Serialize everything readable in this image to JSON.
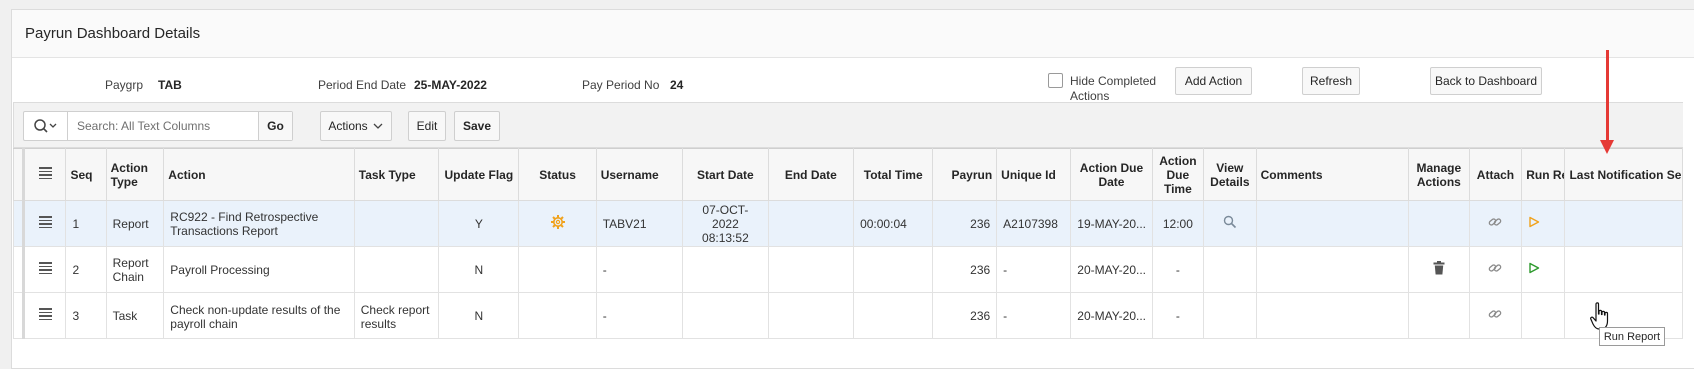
{
  "region": {
    "title": "Payrun Dashboard Details"
  },
  "info": {
    "paygrp_label": "Paygrp",
    "paygrp_value": "TAB",
    "period_end_label": "Period End Date",
    "period_end_value": "25-MAY-2022",
    "pay_period_label": "Pay Period No",
    "pay_period_value": "24"
  },
  "controls": {
    "hide_completed_label_1": "Hide Completed",
    "hide_completed_label_2": "Actions",
    "hide_completed_checked": false,
    "add_action": "Add Action",
    "refresh": "Refresh",
    "back": "Back to Dashboard"
  },
  "toolbar": {
    "search_placeholder": "Search: All Text Columns",
    "go": "Go",
    "actions": "Actions",
    "edit": "Edit",
    "save": "Save"
  },
  "columns": [
    {
      "label": "Seq"
    },
    {
      "label": "Action Type"
    },
    {
      "label": "Action"
    },
    {
      "label": "Task Type"
    },
    {
      "label": "Update Flag"
    },
    {
      "label": "Status"
    },
    {
      "label": "Username"
    },
    {
      "label": "Start Date"
    },
    {
      "label": "End Date"
    },
    {
      "label": "Total Time"
    },
    {
      "label": "Payrun"
    },
    {
      "label": "Unique Id"
    },
    {
      "label": "Action Due Date"
    },
    {
      "label": "Action Due Time"
    },
    {
      "label": "View Details"
    },
    {
      "label": "Comments"
    },
    {
      "label": "Manage Actions"
    },
    {
      "label": "Attach"
    },
    {
      "label": "Run Report"
    },
    {
      "label": "Last Notification Sent"
    }
  ],
  "rows": [
    {
      "seq": "1",
      "action_type": "Report",
      "action": "RC922 - Find Retrospective Transactions Report",
      "task_type": "",
      "update_flag": "Y",
      "status_icon": "gear-icon",
      "username": "TABV21",
      "start_date": "07-OCT-2022 08:13:52",
      "end_date": "",
      "total_time": "00:00:04",
      "payrun": "236",
      "unique_id": "A2107398",
      "due_date": "19-MAY-20...",
      "due_time": "12:00",
      "view_icon": "search-icon",
      "comments": "",
      "manage_icon": "",
      "attach_icon": "link-icon",
      "run_icon": "play-icon-orange",
      "selected": true
    },
    {
      "seq": "2",
      "action_type": "Report Chain",
      "action": "Payroll Processing",
      "task_type": "",
      "update_flag": "N",
      "status_icon": "",
      "username": "-",
      "start_date": "",
      "end_date": "",
      "total_time": "",
      "payrun": "236",
      "unique_id": "-",
      "due_date": "20-MAY-20...",
      "due_time": "-",
      "view_icon": "",
      "comments": "",
      "manage_icon": "trash-icon",
      "attach_icon": "link-icon",
      "run_icon": "play-icon-green",
      "selected": false
    },
    {
      "seq": "3",
      "action_type": "Task",
      "action": "Check non-update results of the payroll chain",
      "task_type": "Check report results",
      "update_flag": "N",
      "status_icon": "",
      "username": "-",
      "start_date": "",
      "end_date": "",
      "total_time": "",
      "payrun": "236",
      "unique_id": "-",
      "due_date": "20-MAY-20...",
      "due_time": "-",
      "view_icon": "",
      "comments": "",
      "manage_icon": "",
      "attach_icon": "link-icon",
      "run_icon": "",
      "selected": false
    }
  ],
  "tooltip": "Run Report",
  "colors": {
    "accent_orange": "#f0a21c",
    "run_green": "#2e9a2e",
    "annotation_red": "#e53935"
  }
}
